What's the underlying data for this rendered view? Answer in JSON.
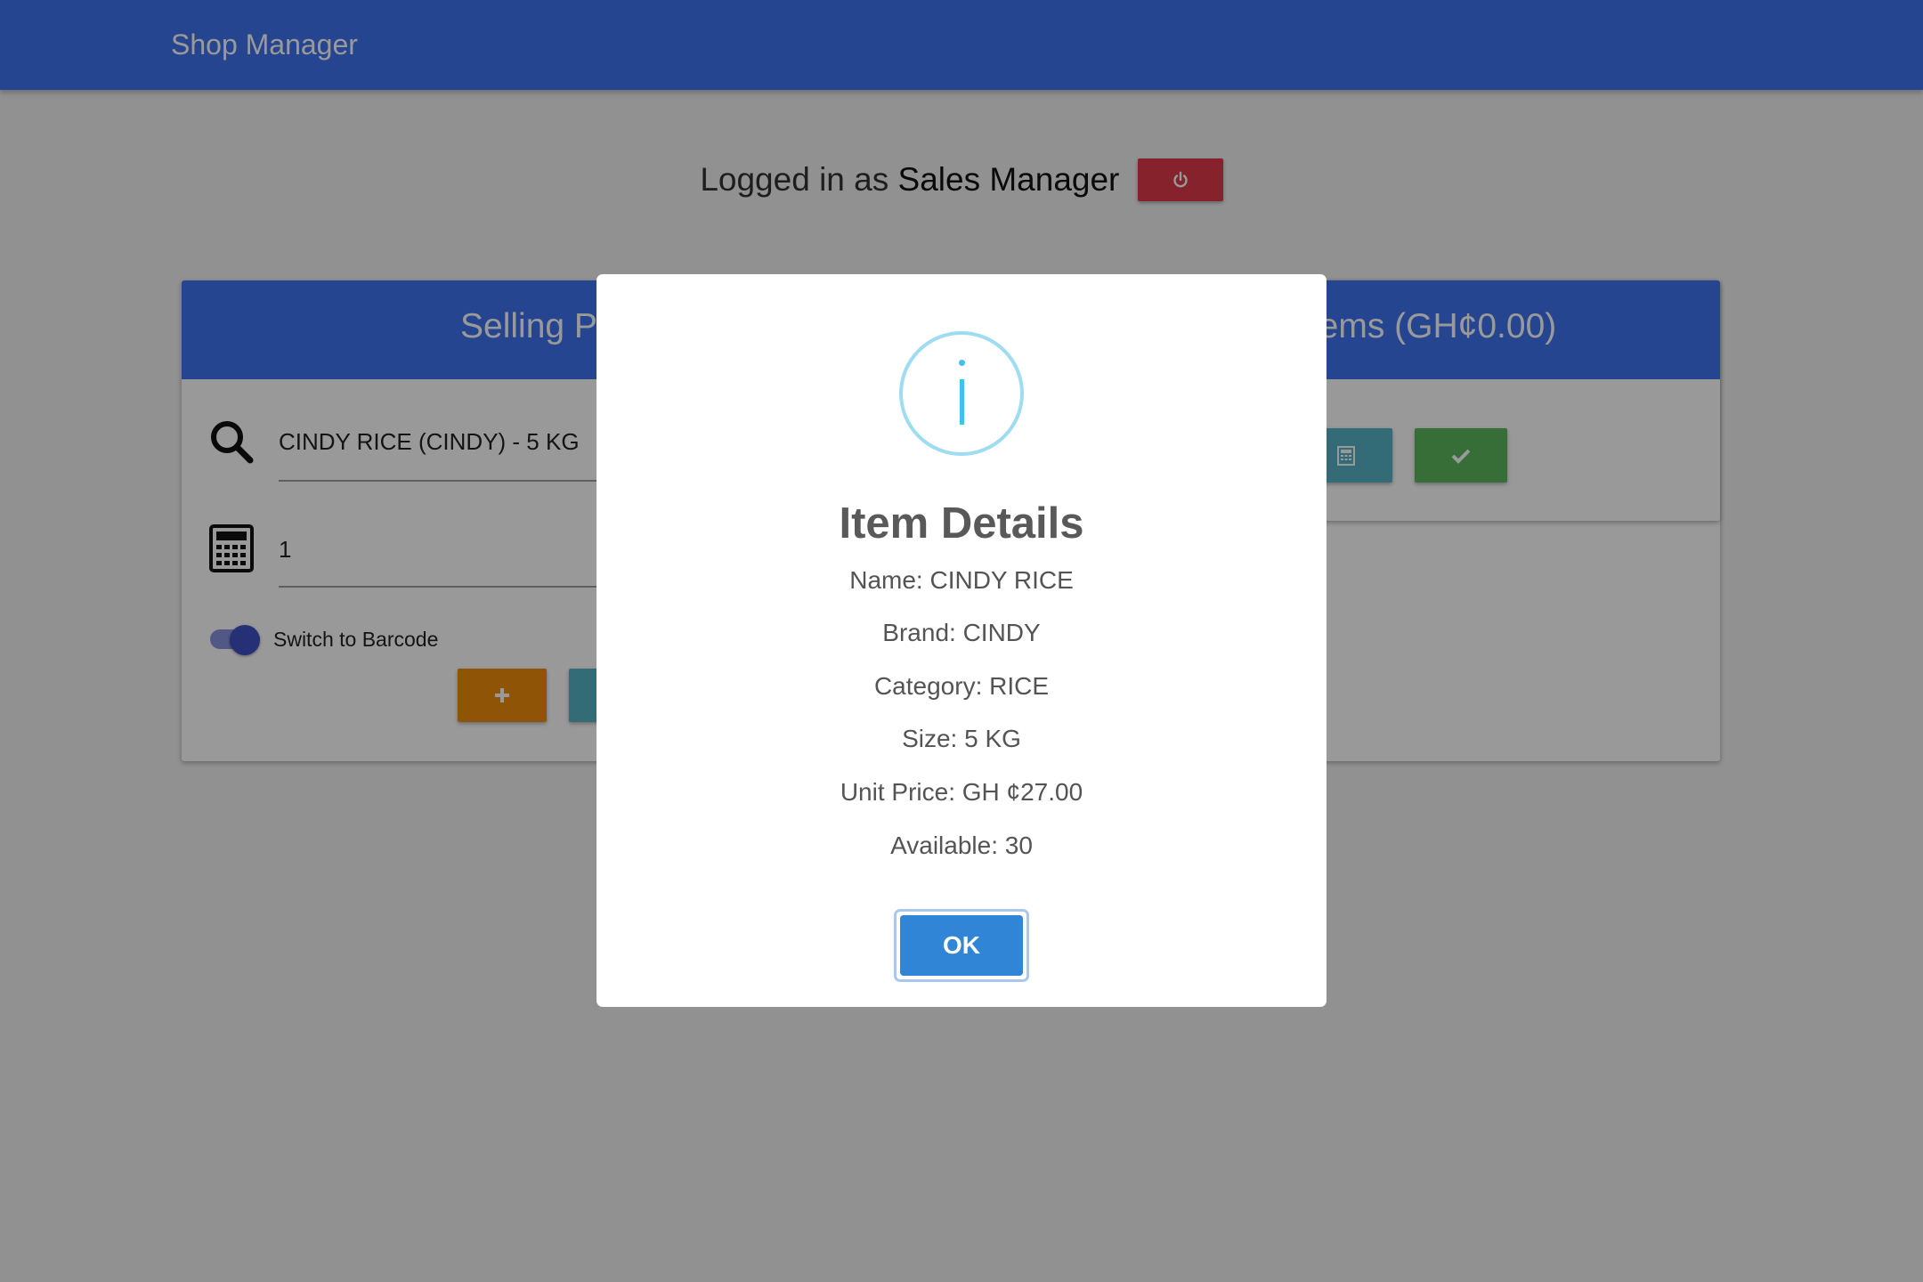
{
  "app": {
    "title": "Shop Manager"
  },
  "session": {
    "prefix": "Logged in as",
    "user_role": "Sales Manager",
    "logout_icon": "power-icon",
    "logout_color": "#e0394a"
  },
  "selling_panel": {
    "title": "Selling Panel",
    "search_value": "CINDY RICE (CINDY) - 5 KG",
    "search_icon": "search-icon",
    "quantity_value": "1",
    "quantity_icon": "calculator-icon",
    "barcode_toggle_label": "Switch to Barcode",
    "barcode_toggle_on": true,
    "add_button_icon": "plus-icon",
    "add_button_color": "#f08c0a"
  },
  "items_panel": {
    "title": "Items (GH¢0.00)",
    "calc_button_icon": "calculator-icon",
    "calc_button_color": "#55b4c7",
    "confirm_button_icon": "check-icon",
    "confirm_button_color": "#5cb85c"
  },
  "dialog": {
    "icon": "info-icon",
    "title": "Item Details",
    "name": "Name: CINDY RICE",
    "brand": "Brand: CINDY",
    "category": "Category: RICE",
    "size": "Size: 5 KG",
    "unit_price": "Unit Price: GH ¢27.00",
    "available": "Available: 30",
    "ok_label": "OK"
  }
}
